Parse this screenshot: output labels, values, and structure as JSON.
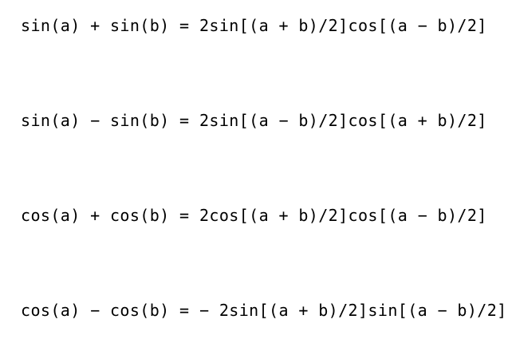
{
  "formulas": [
    "sin(a) + sin(b) = 2sin[(a + b)/2]cos[(a − b)/2]",
    "sin(a) − sin(b) = 2sin[(a − b)/2]cos[(a + b)/2]",
    "cos(a) + cos(b) = 2cos[(a + b)/2]cos[(a − b)/2]",
    "cos(a) − cos(b) = − 2sin[(a + b)/2]sin[(a − b)/2]"
  ],
  "colors": {
    "background": "#ffffff",
    "text": "#000000"
  }
}
